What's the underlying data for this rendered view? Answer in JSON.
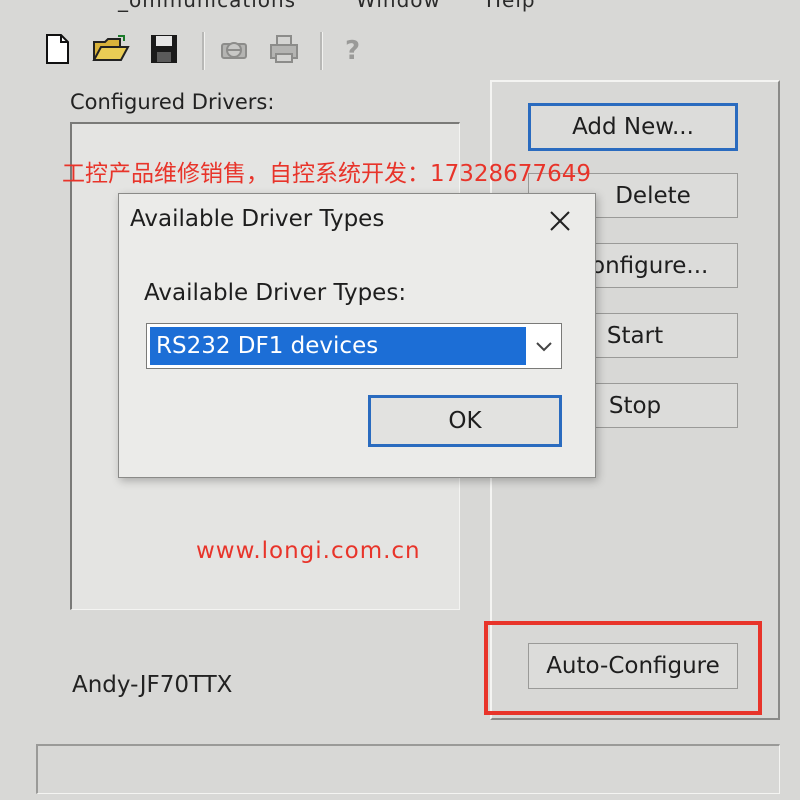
{
  "menu": {
    "items": [
      "_ommunications",
      "Window",
      "Help"
    ]
  },
  "toolbar": {
    "icons": [
      "new-document-icon",
      "open-folder-icon",
      "save-disk-icon",
      "print-preview-icon",
      "print-icon",
      "help-question-icon"
    ]
  },
  "drivers_panel": {
    "label": "Configured Drivers:"
  },
  "buttons": {
    "add_new": "Add New...",
    "delete": "Delete",
    "configure": "onfigure...",
    "start": "Start",
    "stop": "Stop",
    "auto_configure": "Auto-Configure"
  },
  "node_name": "Andy-JF70TTX",
  "watermark": {
    "top": "工控产品维修销售，自控系统开发：17328677649",
    "url": "www.longi.com.cn"
  },
  "dialog": {
    "title": "Available Driver Types",
    "label": "Available Driver Types:",
    "selected_value": "RS232 DF1 devices",
    "ok": "OK"
  },
  "colors": {
    "focus_blue": "#2a6bbf",
    "selection_blue": "#1c6ed6",
    "highlight_red": "#e8342a",
    "window_bg": "#d8d8d6"
  }
}
